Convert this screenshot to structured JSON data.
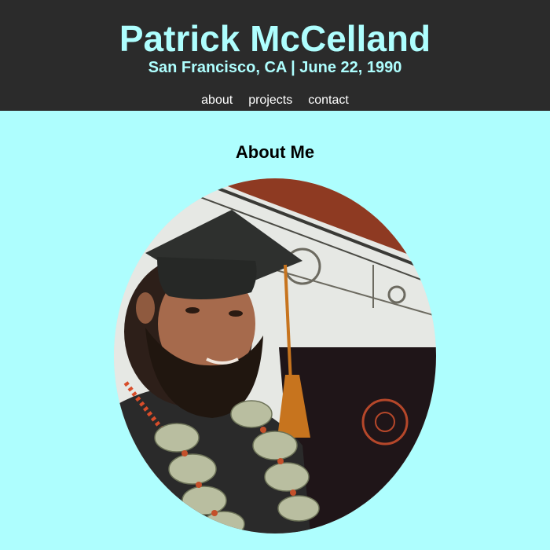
{
  "header": {
    "title": "Patrick McCelland",
    "subtitle": "San Francisco, CA | June 22, 1990"
  },
  "nav": {
    "items": [
      {
        "label": "about"
      },
      {
        "label": "projects"
      },
      {
        "label": "contact"
      }
    ]
  },
  "main": {
    "section_title": "About Me",
    "photo": {
      "subject": "graduation portrait with cap, tassel and money lei"
    }
  },
  "colors": {
    "header_bg": "#2b2b2b",
    "accent": "#aefefe",
    "nav_text": "#ffffff",
    "page_bg": "#aefefe"
  }
}
